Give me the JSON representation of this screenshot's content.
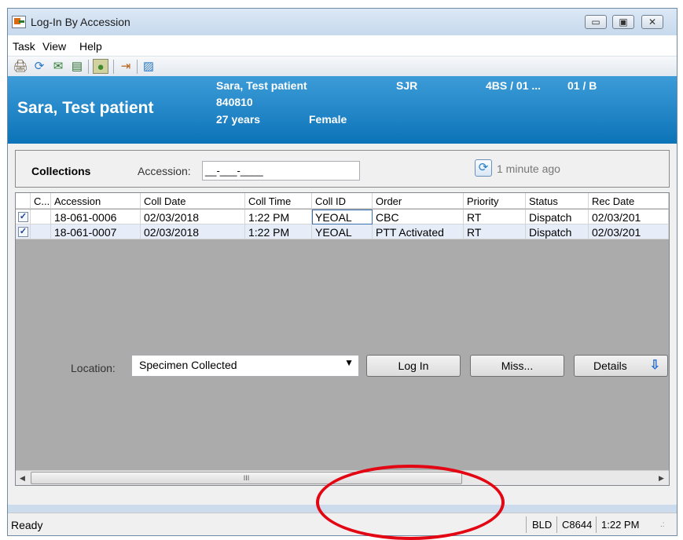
{
  "window": {
    "title": "Log-In By Accession",
    "minimize": "▭",
    "maximize": "▣",
    "close": "✕"
  },
  "menu": [
    "Task",
    "View",
    "Help"
  ],
  "toolbar": [
    {
      "icon": "print-icon",
      "glyph": "🖨"
    },
    {
      "icon": "refresh-icon",
      "glyph": "⟳"
    },
    {
      "icon": "message-icon",
      "glyph": "✉"
    },
    {
      "icon": "document-icon",
      "glyph": "▤"
    },
    {
      "icon": "comment-icon",
      "glyph": "●"
    },
    {
      "icon": "exit-icon",
      "glyph": "⇥"
    },
    {
      "icon": "image-icon",
      "glyph": "▨"
    }
  ],
  "patient": {
    "name_large": "Sara, Test patient",
    "name": "Sara, Test patient",
    "mrn": "840810",
    "age": "27 years",
    "sex": "Female",
    "facility": "SJR",
    "location": "4BS / 01 ...",
    "bed": "01 / B"
  },
  "collections": {
    "title": "Collections",
    "accession_label": "Accession:",
    "accession_value": "__-___-____",
    "refresh_text": "1 minute ago"
  },
  "grid": {
    "columns": [
      "C...",
      "Accession",
      "Coll Date",
      "Coll Time",
      "Coll ID",
      "Order",
      "Priority",
      "Status",
      "Rec Date"
    ],
    "rows": [
      {
        "checked": true,
        "c": "",
        "accession": "18-061-0006",
        "coll_date": "02/03/2018",
        "coll_time": "1:22 PM",
        "coll_id": "YEOAL",
        "order": "CBC",
        "priority": "RT",
        "status": "Dispatch",
        "rec_date": "02/03/201"
      },
      {
        "checked": true,
        "c": "",
        "accession": "18-061-0007",
        "coll_date": "02/03/2018",
        "coll_time": "1:22 PM",
        "coll_id": "YEOAL",
        "order": "PTT Activated",
        "priority": "RT",
        "status": "Dispatch",
        "rec_date": "02/03/201"
      }
    ],
    "scroll_left": "◀",
    "scroll_right": "▶",
    "scroll_grip": "III"
  },
  "footer": {
    "location_label": "Location:",
    "location_value": "Specimen Collected",
    "login_button": "Log In",
    "miss_button": "Miss...",
    "details_button": "Details"
  },
  "statusbar": {
    "status": "Ready",
    "dept": "BLD",
    "user": "C8644",
    "time": "1:22 PM"
  },
  "colors": {
    "banner": "#1583c8",
    "callout": "#e30613"
  }
}
